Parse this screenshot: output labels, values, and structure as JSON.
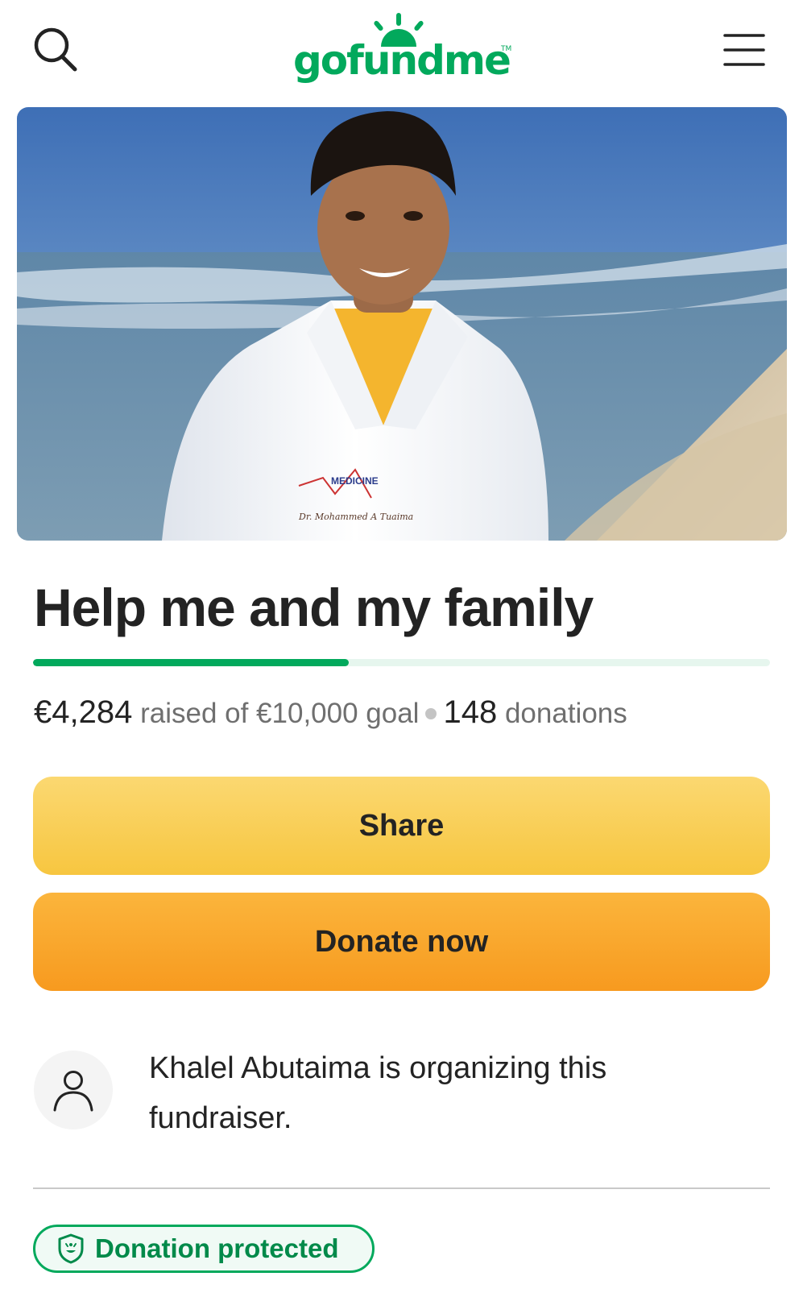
{
  "header": {
    "logo_text": "gofundme",
    "logo_tm": "TM",
    "search_icon": "search-icon",
    "menu_icon": "hamburger-menu-icon"
  },
  "hero": {
    "image": "photo of smiling young man in white lab coat on a beach",
    "coat_text_1": "MEDICINE",
    "coat_text_2": "Dr. Mohammed A Tuaima"
  },
  "campaign": {
    "title": "Help me and my family",
    "progress_fraction": 0.4284,
    "raised_amount": "€4,284",
    "raised_of_text": "raised of €10,000 goal",
    "donations_count": "148",
    "donations_label": "donations"
  },
  "buttons": {
    "share_label": "Share",
    "donate_label": "Donate now"
  },
  "organizer": {
    "avatar_icon": "user-icon",
    "text": "Khalel Abutaima is organizing this fundraiser."
  },
  "badge": {
    "icon": "shield-icon",
    "label": "Donation protected"
  },
  "colors": {
    "brand_green": "#02a95c",
    "share_yellow": "#f7c640",
    "donate_orange": "#f79a1f"
  }
}
